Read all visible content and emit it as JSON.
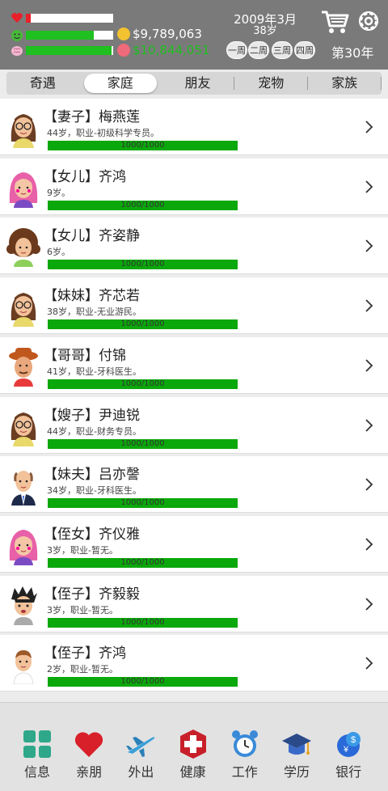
{
  "header": {
    "money": "$9,789,063",
    "deposit": "$10,844,051",
    "date": "2009年3月",
    "age": "38岁",
    "weeks": [
      "一周",
      "二周",
      "三周",
      "四周"
    ],
    "week_no": "第30年",
    "stats": {
      "health": 0.06,
      "mood": 0.78,
      "mind": 0.98
    },
    "colors": {
      "health": "#e8202a",
      "bar": "#1fc01f",
      "deposit": "#1fc01f"
    }
  },
  "tabs": [
    {
      "label": "奇遇"
    },
    {
      "label": "家庭",
      "selected": true
    },
    {
      "label": "朋友"
    },
    {
      "label": "宠物"
    },
    {
      "label": "家族"
    }
  ],
  "family": [
    {
      "name": "【妻子】梅燕莲",
      "info": "44岁，职业-初级科学专员。",
      "hp": "1000/1000",
      "avatar": "woman-glasses-icon"
    },
    {
      "name": "【女儿】齐鸿",
      "info": "9岁。",
      "hp": "1000/1000",
      "avatar": "girl-pink-hair-icon"
    },
    {
      "name": "【女儿】齐姿静",
      "info": "6岁。",
      "hp": "1000/1000",
      "avatar": "girl-curly-hair-icon"
    },
    {
      "name": "【妹妹】齐芯若",
      "info": "38岁，职业-无业游民。",
      "hp": "1000/1000",
      "avatar": "woman-glasses-icon"
    },
    {
      "name": "【哥哥】付锦",
      "info": "41岁，职业-牙科医生。",
      "hp": "1000/1000",
      "avatar": "man-hat-icon"
    },
    {
      "name": "【嫂子】尹迪锐",
      "info": "44岁，职业-财务专员。",
      "hp": "1000/1000",
      "avatar": "woman-glasses-icon"
    },
    {
      "name": "【妹夫】吕亦謦",
      "info": "34岁，职业-牙科医生。",
      "hp": "1000/1000",
      "avatar": "bald-man-suit-icon"
    },
    {
      "name": "【侄女】齐仪雅",
      "info": "3岁，职业-暂无。",
      "hp": "1000/1000",
      "avatar": "girl-pink-hair-icon"
    },
    {
      "name": "【侄子】齐毅毅",
      "info": "3岁，职业-暂无。",
      "hp": "1000/1000",
      "avatar": "boy-spiky-hair-icon"
    },
    {
      "name": "【侄子】齐鸿",
      "info": "2岁，职业-暂无。",
      "hp": "1000/1000",
      "avatar": "boy-icon"
    }
  ],
  "bottom_nav": [
    {
      "label": "信息",
      "icon": "info-grid-icon"
    },
    {
      "label": "亲朋",
      "icon": "heart-icon"
    },
    {
      "label": "外出",
      "icon": "airplane-icon"
    },
    {
      "label": "健康",
      "icon": "medical-cross-icon"
    },
    {
      "label": "工作",
      "icon": "alarm-clock-icon"
    },
    {
      "label": "学历",
      "icon": "graduation-cap-icon"
    },
    {
      "label": "银行",
      "icon": "bank-money-icon"
    }
  ]
}
